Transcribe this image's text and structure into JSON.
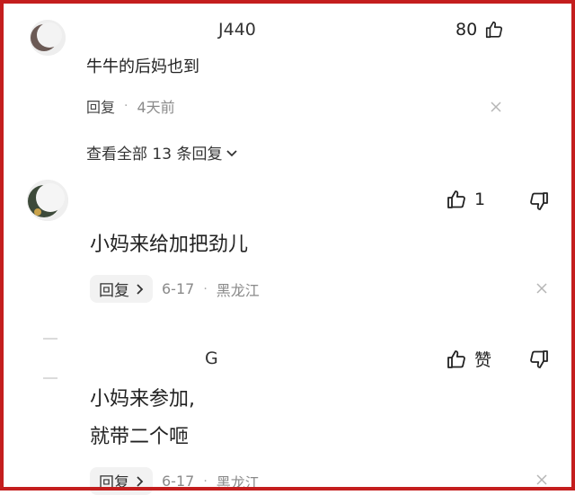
{
  "comments": [
    {
      "username": "J440",
      "like_count": "80",
      "text": "牛牛的后妈也到",
      "reply_label": "回复",
      "separator": "·",
      "time": "4天前",
      "view_all": "查看全部 13 条回复"
    },
    {
      "like_count": "1",
      "text": "小妈来给加把劲儿",
      "reply_label": "回复",
      "date": "6-17",
      "separator": "·",
      "location": "黑龙江"
    },
    {
      "username": "G",
      "like_label": "赞",
      "text_line1": "小妈来参加,",
      "text_line2": "就带二个咂",
      "reply_label": "回复",
      "date": "6-17",
      "separator": "·",
      "location": "黑龙江"
    }
  ],
  "colors": {
    "frame": "#c41e1e",
    "text": "#222222",
    "meta": "#8a8a8a"
  },
  "icons": [
    "thumb-up-icon",
    "thumb-down-icon",
    "close-icon",
    "chevron-down-icon",
    "chevron-right-icon"
  ]
}
